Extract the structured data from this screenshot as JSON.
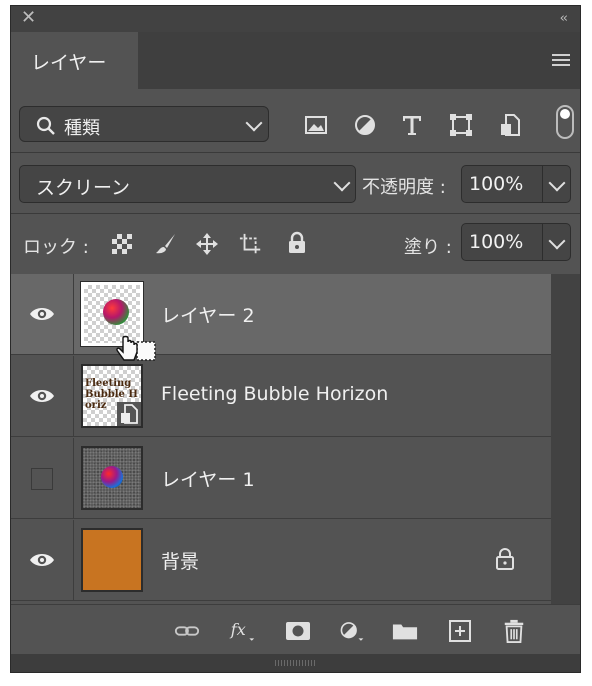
{
  "panel": {
    "close_glyph": "✕",
    "collapse_glyph": "‹‹",
    "tab_label": "レイヤー"
  },
  "filter": {
    "kind_label": "種類",
    "icons": [
      "image-filter-icon",
      "adjustment-filter-icon",
      "type-filter-icon",
      "shape-filter-icon",
      "smart-object-filter-icon"
    ]
  },
  "blend": {
    "mode_value": "スクリーン",
    "opacity_label": "不透明度 :",
    "opacity_value": "100%"
  },
  "lock": {
    "label": "ロック :",
    "fill_label": "塗り :",
    "fill_value": "100%"
  },
  "layers": [
    {
      "name": "レイヤー 2",
      "visible": true,
      "selected": true
    },
    {
      "name": "Fleeting Bubble Horizon",
      "visible": true,
      "selected": false,
      "thumb_text": "Fleeting Bubble Horiz"
    },
    {
      "name": "レイヤー 1",
      "visible": false,
      "selected": false
    },
    {
      "name": "背景",
      "visible": true,
      "selected": false,
      "locked": true
    }
  ],
  "colors": {
    "panel_bg": "#535353",
    "selected_row": "#686868",
    "background_layer_fill": "#c87421"
  }
}
